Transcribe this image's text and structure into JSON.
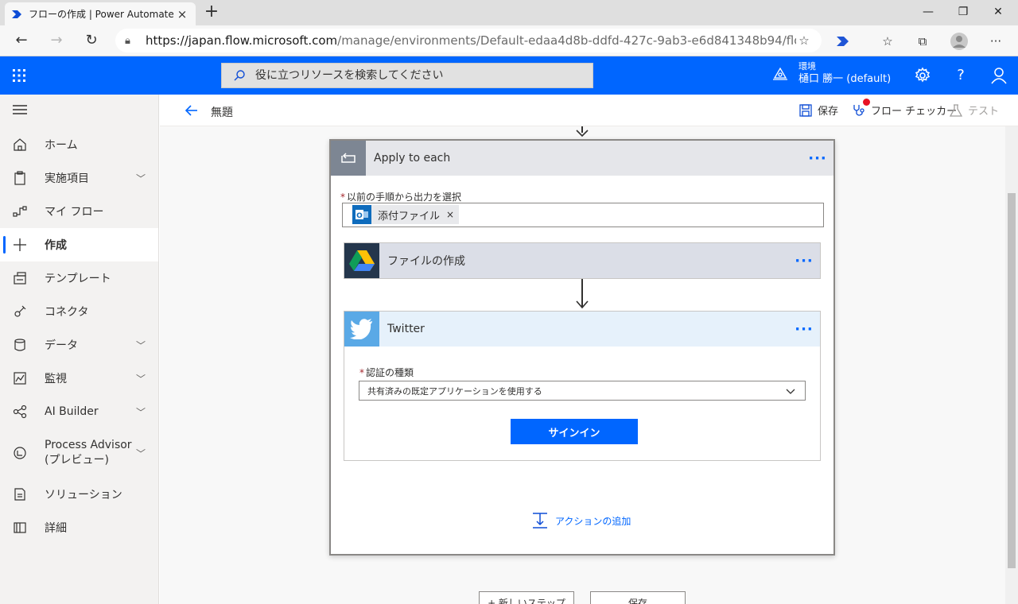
{
  "browser": {
    "tab_title": "フローの作成 | Power Automate",
    "url_host": "https://japan.flow.microsoft.com",
    "url_path": "/manage/environments/Default-edaa4d8b-ddfd-427c-9ab3-e6d841348b94/flo..."
  },
  "header": {
    "search_placeholder": "役に立つリソースを検索してください",
    "env_label": "環境",
    "env_name": "樋口 勝一 (default)"
  },
  "sidebar": {
    "items": [
      {
        "label": "ホーム",
        "icon": "home-icon",
        "chevron": false
      },
      {
        "label": "実施項目",
        "icon": "clipboard-icon",
        "chevron": true
      },
      {
        "label": "マイ フロー",
        "icon": "flow-icon",
        "chevron": false
      },
      {
        "label": "作成",
        "icon": "plus-icon",
        "chevron": false,
        "active": true
      },
      {
        "label": "テンプレート",
        "icon": "template-icon",
        "chevron": false
      },
      {
        "label": "コネクタ",
        "icon": "connector-icon",
        "chevron": false
      },
      {
        "label": "データ",
        "icon": "database-icon",
        "chevron": true
      },
      {
        "label": "監視",
        "icon": "chart-icon",
        "chevron": true
      },
      {
        "label": "AI Builder",
        "icon": "ai-icon",
        "chevron": true
      },
      {
        "label": "Process Advisor (プレビュー)",
        "line1": "Process Advisor",
        "line2": "(プレビュー)",
        "icon": "process-icon",
        "chevron": true
      },
      {
        "label": "ソリューション",
        "icon": "solution-icon",
        "chevron": false
      },
      {
        "label": "詳細",
        "icon": "book-icon",
        "chevron": false
      }
    ]
  },
  "cmdbar": {
    "flow_name": "無題",
    "save": "保存",
    "checker": "フロー チェッカー",
    "test": "テスト"
  },
  "apply_to_each": {
    "title": "Apply to each",
    "field_label": "以前の手順から出力を選択",
    "token_label": "添付ファイル",
    "token_remove": "×"
  },
  "actions": {
    "drive_title": "ファイルの作成",
    "twitter_title": "Twitter",
    "auth_label": "認証の種類",
    "auth_value": "共有済みの既定アプリケーションを使用する",
    "signin": "サインイン",
    "add_action": "アクションの追加"
  },
  "footer": {
    "new_step": "+ 新しいステップ",
    "save": "保存"
  },
  "colors": {
    "accent": "#0066ff",
    "drive_bg": "#24364c",
    "twitter_bg": "#5aa9e6"
  }
}
